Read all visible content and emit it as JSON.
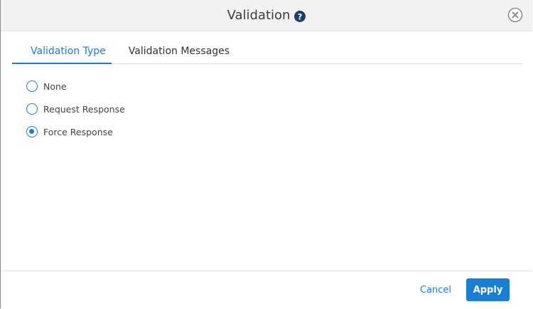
{
  "dialog": {
    "title": "Validation",
    "help_icon": "question-circle-icon",
    "close_icon": "close-circle-icon"
  },
  "tabs": [
    {
      "label": "Validation Type",
      "active": true
    },
    {
      "label": "Validation Messages",
      "active": false
    }
  ],
  "options": [
    {
      "label": "None",
      "checked": false
    },
    {
      "label": "Request Response",
      "checked": false
    },
    {
      "label": "Force Response",
      "checked": true
    }
  ],
  "footer": {
    "cancel_label": "Cancel",
    "apply_label": "Apply"
  },
  "colors": {
    "accent": "#1a7ed3",
    "header_bg": "#f2f2f2",
    "help_icon": "#1f3e6e"
  }
}
